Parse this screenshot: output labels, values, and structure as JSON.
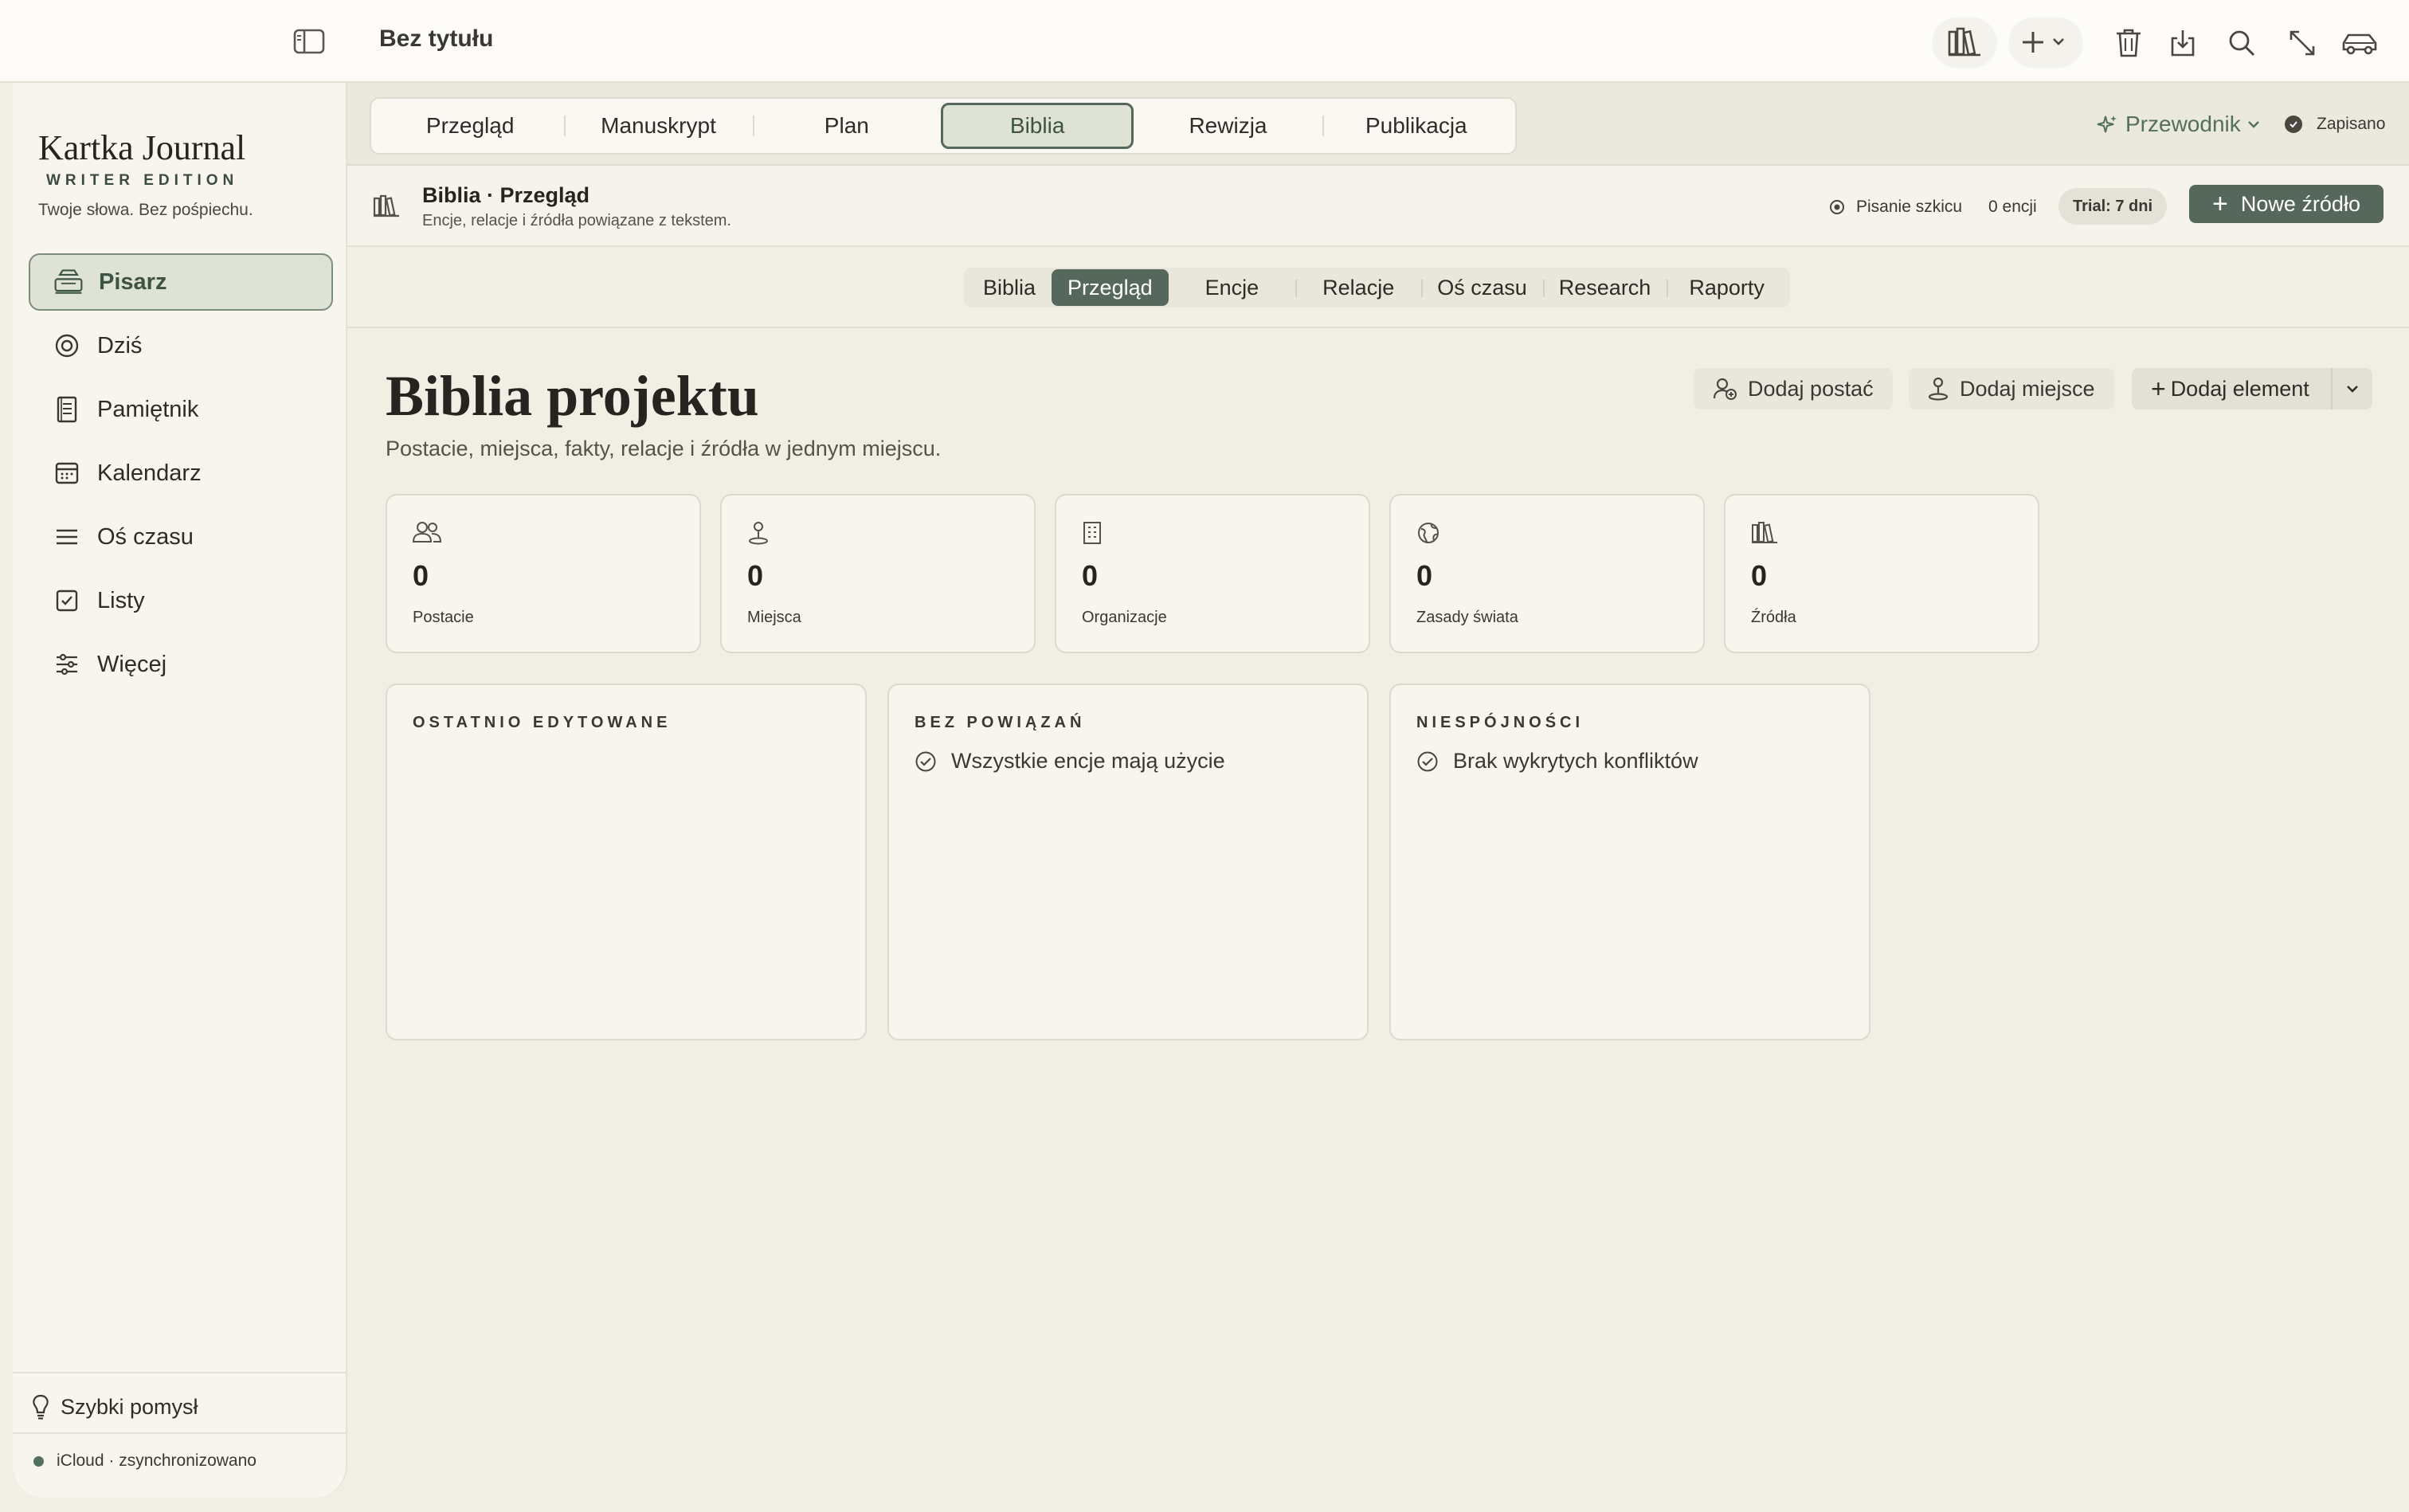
{
  "window": {
    "doc_title": "Bez tytułu"
  },
  "sidebar": {
    "brand_title": "Kartka Journal",
    "brand_edition": "WRITER EDITION",
    "brand_tagline": "Twoje słowa. Bez pośpiechu.",
    "items": [
      {
        "label": "Pisarz",
        "icon": "typewriter-icon",
        "active": true
      },
      {
        "label": "Dziś",
        "icon": "target-icon"
      },
      {
        "label": "Pamiętnik",
        "icon": "journal-icon"
      },
      {
        "label": "Kalendarz",
        "icon": "calendar-icon"
      },
      {
        "label": "Oś czasu",
        "icon": "timeline-icon"
      },
      {
        "label": "Listy",
        "icon": "checklist-icon"
      },
      {
        "label": "Więcej",
        "icon": "sliders-icon"
      }
    ],
    "quick_idea": "Szybki pomysł",
    "sync_status": "iCloud · zsynchronizowano"
  },
  "tabs": {
    "items": [
      "Przegląd",
      "Manuskrypt",
      "Plan",
      "Biblia",
      "Rewizja",
      "Publikacja"
    ],
    "active": "Biblia"
  },
  "topbar_right": {
    "guide_label": "Przewodnik",
    "saved_label": "Zapisano"
  },
  "header_strip": {
    "title": "Biblia · Przegląd",
    "subtitle": "Encje, relacje i źródła powiązane z tekstem.",
    "status": "Pisanie szkicu",
    "entity_count": "0 encji",
    "trial": "Trial: 7 dni",
    "new_source": "Nowe źródło"
  },
  "subtabs": {
    "items": [
      "Biblia",
      "Przegląd",
      "Encje",
      "Relacje",
      "Oś czasu",
      "Research",
      "Raporty"
    ],
    "active": "Przegląd"
  },
  "page": {
    "title": "Biblia projektu",
    "subtitle": "Postacie, miejsca, fakty, relacje i źródła w jednym miejscu.",
    "add_character": "Dodaj postać",
    "add_place": "Dodaj miejsce",
    "add_element": "Dodaj element"
  },
  "stats": [
    {
      "value": "0",
      "label": "Postacie",
      "icon": "people-icon"
    },
    {
      "value": "0",
      "label": "Miejsca",
      "icon": "pin-icon"
    },
    {
      "value": "0",
      "label": "Organizacje",
      "icon": "building-icon"
    },
    {
      "value": "0",
      "label": "Zasady świata",
      "icon": "globe-icon"
    },
    {
      "value": "0",
      "label": "Źródła",
      "icon": "library-icon"
    }
  ],
  "panels": [
    {
      "title": "OSTATNIO EDYTOWANE",
      "text": ""
    },
    {
      "title": "BEZ POWIĄZAŃ",
      "text": "Wszystkie encje mają użycie"
    },
    {
      "title": "NIESPÓJNOŚCI",
      "text": "Brak wykrytych konfliktów"
    }
  ],
  "colors": {
    "accent": "#55685b",
    "background": "#f1eee4",
    "card": "#f7f5ed"
  }
}
